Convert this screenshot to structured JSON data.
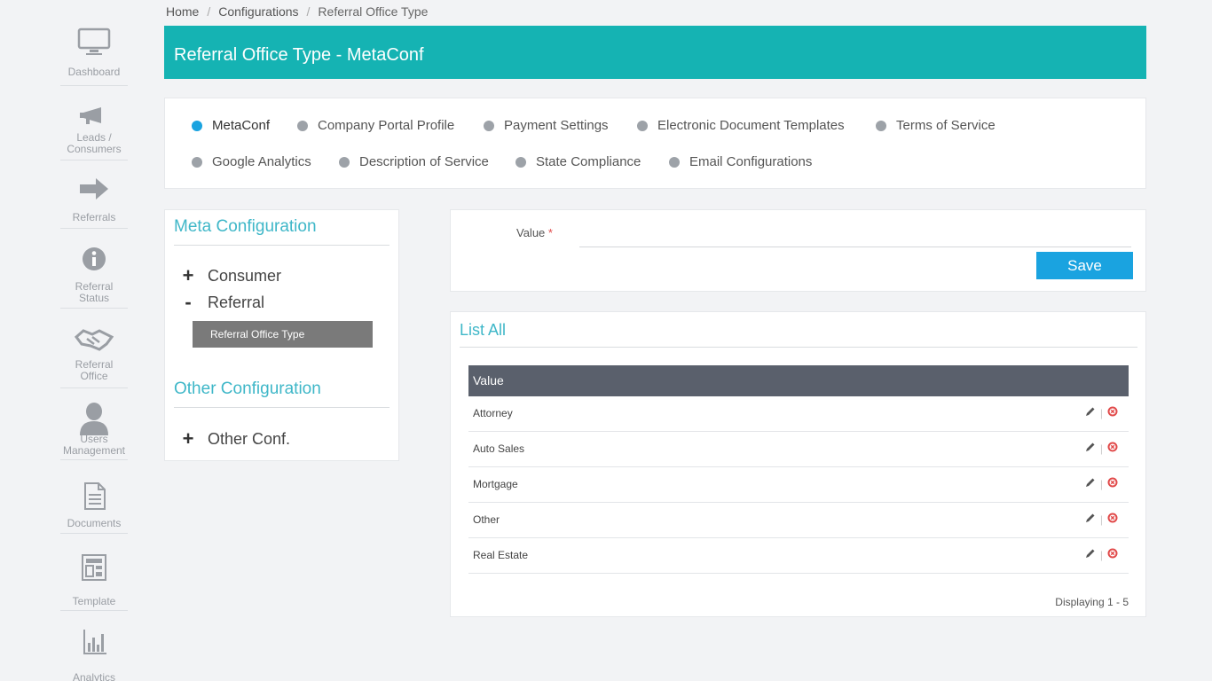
{
  "sidebar": {
    "items": [
      {
        "label": "Dashboard",
        "icon": "monitor-icon"
      },
      {
        "label": "Leads / Consumers",
        "icon": "megaphone-icon"
      },
      {
        "label": "Referrals",
        "icon": "arrow-right-icon"
      },
      {
        "label": "Referral Status",
        "icon": "info-icon"
      },
      {
        "label": "Referral Office",
        "icon": "handshake-icon"
      },
      {
        "label": "Users Management",
        "icon": "user-icon"
      },
      {
        "label": "Documents",
        "icon": "document-icon"
      },
      {
        "label": "Template",
        "icon": "template-icon"
      },
      {
        "label": "Analytics",
        "icon": "bar-chart-icon"
      }
    ]
  },
  "breadcrumb": [
    "Home",
    "Configurations",
    "Referral Office Type"
  ],
  "header": {
    "title": "Referral Office Type - MetaConf"
  },
  "tabs": [
    {
      "label": "MetaConf",
      "active": true
    },
    {
      "label": "Company Portal Profile",
      "active": false
    },
    {
      "label": "Payment Settings",
      "active": false
    },
    {
      "label": "Electronic Document Templates",
      "active": false
    },
    {
      "label": "Terms of Service",
      "active": false
    },
    {
      "label": "Google Analytics",
      "active": false
    },
    {
      "label": "Description of Service",
      "active": false
    },
    {
      "label": "State Compliance",
      "active": false
    },
    {
      "label": "Email Configurations",
      "active": false
    }
  ],
  "meta": {
    "title": "Meta Configuration",
    "consumer": "Consumer",
    "referral": "Referral",
    "selected": "Referral Office Type",
    "other_title": "Other Configuration",
    "other_item": "Other Conf.",
    "plus": "+",
    "minus": "-"
  },
  "form": {
    "value_label": "Value",
    "required_mark": "*",
    "value": "",
    "save_label": "Save"
  },
  "list": {
    "title": "List All",
    "column": "Value",
    "rows": [
      "Attorney",
      "Auto Sales",
      "Mortgage",
      "Other",
      "Real Estate"
    ],
    "footer": "Displaying 1 - 5"
  },
  "colors": {
    "accent": "#15b3b3",
    "primary": "#1aa3e0",
    "delete": "#e14b4b"
  }
}
